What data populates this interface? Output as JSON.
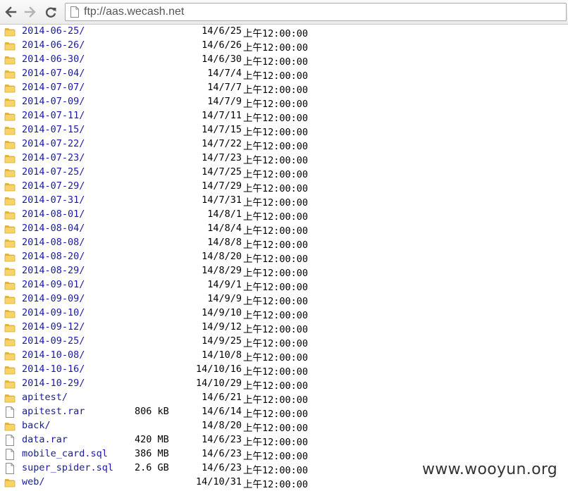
{
  "browser": {
    "url": "ftp://aas.wecash.net"
  },
  "icons": {
    "back": "arrow-left-icon",
    "forward": "arrow-right-icon",
    "reload": "reload-icon",
    "page": "page-icon",
    "folder": "folder-icon",
    "file": "file-icon"
  },
  "colors": {
    "link": "#1a1aa6",
    "folder": "#f4c542"
  },
  "listing": {
    "entries": [
      {
        "name": "2014-06-25/",
        "type": "folder",
        "size": "",
        "date": "14/6/25",
        "time": "上午12:00:00"
      },
      {
        "name": "2014-06-26/",
        "type": "folder",
        "size": "",
        "date": "14/6/26",
        "time": "上午12:00:00"
      },
      {
        "name": "2014-06-30/",
        "type": "folder",
        "size": "",
        "date": "14/6/30",
        "time": "上午12:00:00"
      },
      {
        "name": "2014-07-04/",
        "type": "folder",
        "size": "",
        "date": "14/7/4",
        "time": "上午12:00:00"
      },
      {
        "name": "2014-07-07/",
        "type": "folder",
        "size": "",
        "date": "14/7/7",
        "time": "上午12:00:00"
      },
      {
        "name": "2014-07-09/",
        "type": "folder",
        "size": "",
        "date": "14/7/9",
        "time": "上午12:00:00"
      },
      {
        "name": "2014-07-11/",
        "type": "folder",
        "size": "",
        "date": "14/7/11",
        "time": "上午12:00:00"
      },
      {
        "name": "2014-07-15/",
        "type": "folder",
        "size": "",
        "date": "14/7/15",
        "time": "上午12:00:00"
      },
      {
        "name": "2014-07-22/",
        "type": "folder",
        "size": "",
        "date": "14/7/22",
        "time": "上午12:00:00"
      },
      {
        "name": "2014-07-23/",
        "type": "folder",
        "size": "",
        "date": "14/7/23",
        "time": "上午12:00:00"
      },
      {
        "name": "2014-07-25/",
        "type": "folder",
        "size": "",
        "date": "14/7/25",
        "time": "上午12:00:00"
      },
      {
        "name": "2014-07-29/",
        "type": "folder",
        "size": "",
        "date": "14/7/29",
        "time": "上午12:00:00"
      },
      {
        "name": "2014-07-31/",
        "type": "folder",
        "size": "",
        "date": "14/7/31",
        "time": "上午12:00:00"
      },
      {
        "name": "2014-08-01/",
        "type": "folder",
        "size": "",
        "date": "14/8/1",
        "time": "上午12:00:00"
      },
      {
        "name": "2014-08-04/",
        "type": "folder",
        "size": "",
        "date": "14/8/4",
        "time": "上午12:00:00"
      },
      {
        "name": "2014-08-08/",
        "type": "folder",
        "size": "",
        "date": "14/8/8",
        "time": "上午12:00:00"
      },
      {
        "name": "2014-08-20/",
        "type": "folder",
        "size": "",
        "date": "14/8/20",
        "time": "上午12:00:00"
      },
      {
        "name": "2014-08-29/",
        "type": "folder",
        "size": "",
        "date": "14/8/29",
        "time": "上午12:00:00"
      },
      {
        "name": "2014-09-01/",
        "type": "folder",
        "size": "",
        "date": "14/9/1",
        "time": "上午12:00:00"
      },
      {
        "name": "2014-09-09/",
        "type": "folder",
        "size": "",
        "date": "14/9/9",
        "time": "上午12:00:00"
      },
      {
        "name": "2014-09-10/",
        "type": "folder",
        "size": "",
        "date": "14/9/10",
        "time": "上午12:00:00"
      },
      {
        "name": "2014-09-12/",
        "type": "folder",
        "size": "",
        "date": "14/9/12",
        "time": "上午12:00:00"
      },
      {
        "name": "2014-09-25/",
        "type": "folder",
        "size": "",
        "date": "14/9/25",
        "time": "上午12:00:00"
      },
      {
        "name": "2014-10-08/",
        "type": "folder",
        "size": "",
        "date": "14/10/8",
        "time": "上午12:00:00"
      },
      {
        "name": "2014-10-16/",
        "type": "folder",
        "size": "",
        "date": "14/10/16",
        "time": "上午12:00:00"
      },
      {
        "name": "2014-10-29/",
        "type": "folder",
        "size": "",
        "date": "14/10/29",
        "time": "上午12:00:00"
      },
      {
        "name": "apitest/",
        "type": "folder",
        "size": "",
        "date": "14/6/21",
        "time": "上午12:00:00"
      },
      {
        "name": "apitest.rar",
        "type": "file",
        "size": "806 kB",
        "date": "14/6/14",
        "time": "上午12:00:00"
      },
      {
        "name": "back/",
        "type": "folder",
        "size": "",
        "date": "14/8/20",
        "time": "上午12:00:00"
      },
      {
        "name": "data.rar",
        "type": "file",
        "size": "420 MB",
        "date": "14/6/23",
        "time": "上午12:00:00"
      },
      {
        "name": "mobile_card.sql",
        "type": "file",
        "size": "386 MB",
        "date": "14/6/23",
        "time": "上午12:00:00"
      },
      {
        "name": "super_spider.sql",
        "type": "file",
        "size": "2.6 GB",
        "date": "14/6/23",
        "time": "上午12:00:00"
      },
      {
        "name": "web/",
        "type": "folder",
        "size": "",
        "date": "14/10/31",
        "time": "上午12:00:00"
      }
    ]
  },
  "watermark": "www.wooyun.org"
}
